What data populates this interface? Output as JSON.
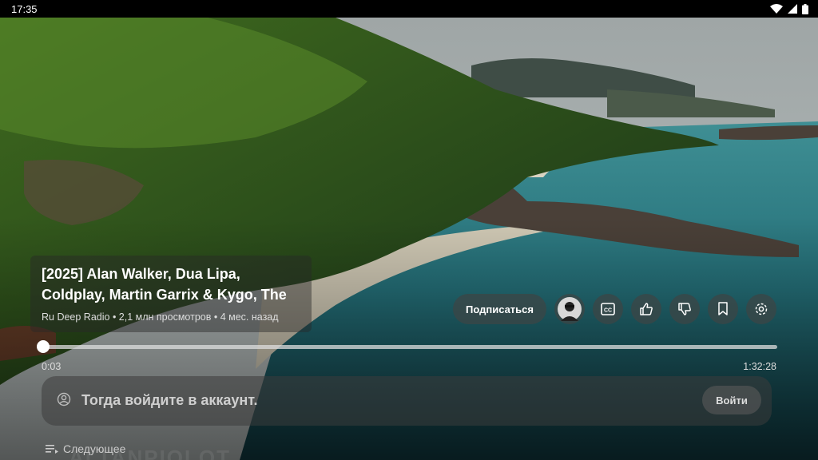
{
  "status_bar": {
    "time": "17:35"
  },
  "video": {
    "title_line1": "[2025] Alan Walker, Dua Lipa,",
    "title_line2": "Coldplay, Martin Garrix & Kygo, The",
    "meta": "Ru Deep Radio • 2,1 млн просмотров • 4 мес. назад",
    "watermark": "ALTANPIOLOT"
  },
  "actions": {
    "subscribe_label": "Подписаться",
    "icons": [
      "avatar",
      "cc-icon",
      "thumb-up-icon",
      "thumb-down-icon",
      "bookmark-icon",
      "gear-icon"
    ]
  },
  "player": {
    "current_time": "0:03",
    "duration": "1:32:28",
    "progress": 0.0005
  },
  "signin": {
    "prompt": "Тогда войдите в аккаунт.",
    "button_label": "Войти"
  },
  "next": {
    "label": "Следующее"
  }
}
